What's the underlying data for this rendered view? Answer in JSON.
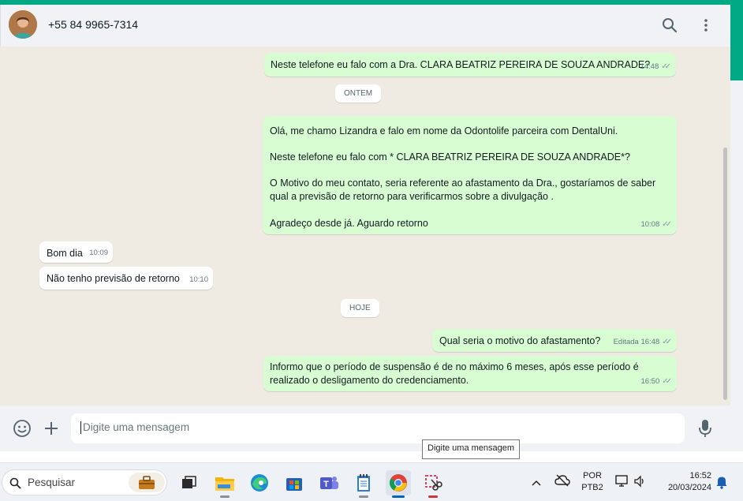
{
  "header": {
    "contact": "+55 84 9965-7314",
    "search_icon": "search-icon",
    "menu_icon": "kebab-menu-icon"
  },
  "messages": [
    {
      "dir": "out",
      "text": "Neste telefone eu falo com a Dra. CLARA BEATRIZ PEREIRA DE SOUZA ANDRADE?",
      "time": "14:48"
    },
    {
      "dir": "out",
      "text1": "Olá, me chamo Lizandra e falo em nome da Odontolife parceira com DentalUni.",
      "text2": "Neste telefone eu falo com * CLARA BEATRIZ PEREIRA DE SOUZA ANDRADE*?",
      "text3a": "O Motivo do meu contato, seria referente ao afastamento da Dra., gostaríamos de saber",
      "text3b": "qual a previsão de retorno para verificarmos sobre a divulgação .",
      "text4": "Agradeço desde já. Aguardo retorno",
      "time": "10:08"
    },
    {
      "dir": "in",
      "text": "Bom dia",
      "time": "10:09"
    },
    {
      "dir": "in",
      "text": "Não tenho previsão de retorno",
      "time": "10:10"
    },
    {
      "dir": "out",
      "text": "Qual seria o motivo do afastamento?",
      "time": "Editada 16:48"
    },
    {
      "dir": "out",
      "text1": "Informo que o período de suspensão é de no máximo 6 meses, após esse período é",
      "text2": "realizado o desligamento do credenciamento.",
      "time": "16:50"
    }
  ],
  "dates": {
    "yesterday": "ONTEM",
    "today": "HOJE"
  },
  "composer": {
    "placeholder": "Digite uma mensagem",
    "tooltip": "Digite uma mensagem"
  },
  "taskbar": {
    "search_label": "Pesquisar",
    "lang_top": "POR",
    "lang_bottom": "PTB2",
    "clock_time": "16:52",
    "clock_date": "20/03/2024"
  },
  "colors": {
    "accent": "#00a884",
    "bubble_out": "#d9fdd3",
    "bubble_in": "#ffffff",
    "chat_bg": "#efeae2"
  }
}
